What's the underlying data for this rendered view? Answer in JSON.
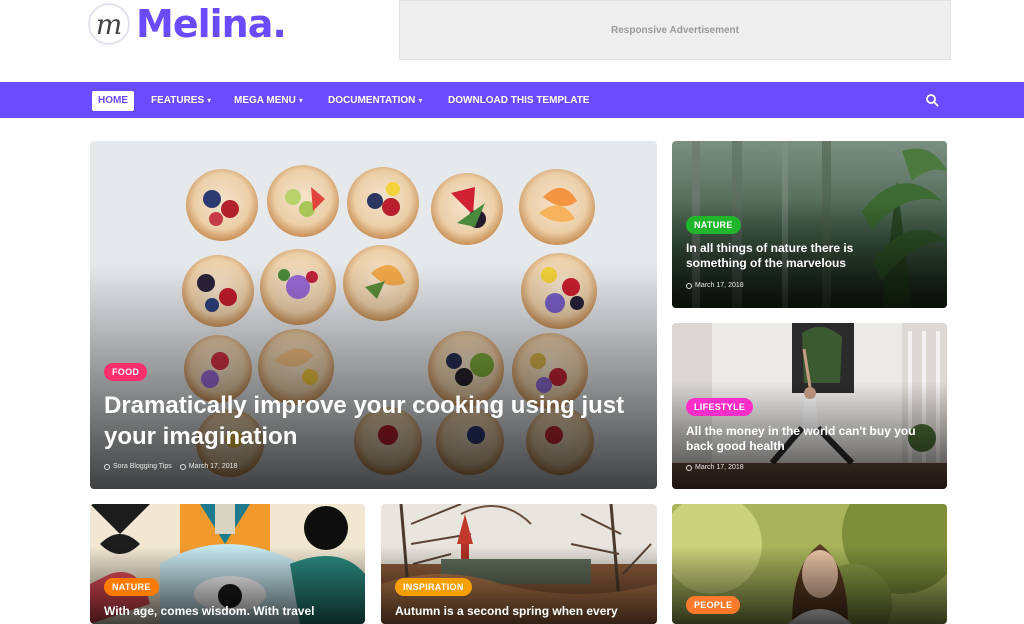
{
  "site": {
    "logo_letter": "m",
    "name": "Melina."
  },
  "ad": {
    "text": "Responsive Advertisement"
  },
  "nav": {
    "items": [
      {
        "label": "HOME",
        "active": true,
        "dropdown": false
      },
      {
        "label": "FEATURES",
        "active": false,
        "dropdown": true
      },
      {
        "label": "MEGA MENU",
        "active": false,
        "dropdown": true
      },
      {
        "label": "DOCUMENTATION",
        "active": false,
        "dropdown": true
      },
      {
        "label": "DOWNLOAD THIS TEMPLATE",
        "active": false,
        "dropdown": false
      }
    ],
    "caret": "▾",
    "search_icon": "search-icon"
  },
  "featured": {
    "badge": "FOOD",
    "title": "Dramatically improve your cooking using just your imagination",
    "author": "Sora Blogging Tips",
    "date": "March 17, 2018"
  },
  "side_posts": [
    {
      "badge": "NATURE",
      "title": "In all things of nature there is something of the marvelous",
      "date": "March 17, 2018"
    },
    {
      "badge": "LIFESTYLE",
      "title": "All the money in the world can't buy you back good health",
      "date": "March 17, 2018"
    }
  ],
  "bottom_posts": [
    {
      "badge": "NATURE",
      "title": "With age, comes wisdom. With travel"
    },
    {
      "badge": "INSPIRATION",
      "title": "Autumn is a second spring when every"
    },
    {
      "badge": "PEOPLE",
      "title": ""
    }
  ],
  "colors": {
    "brand": "#6a4bff",
    "food": "#ff2f6e",
    "nature": "#21b52b",
    "lifestyle": "#ff2ec9",
    "nature_orange": "#ff7a00",
    "inspiration": "#f5a000",
    "people": "#ff7a2a"
  }
}
